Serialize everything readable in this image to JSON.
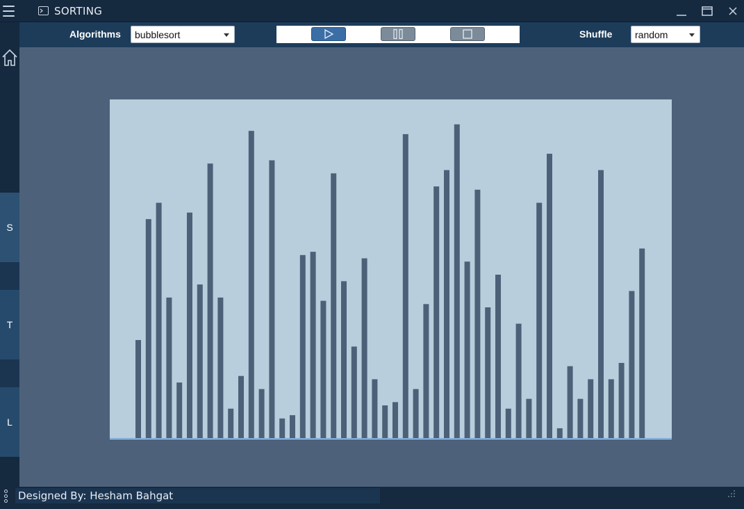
{
  "window": {
    "title": "SORTING",
    "icon": "terminal-icon",
    "controls": [
      "minimize-icon",
      "maximize-icon",
      "close-icon"
    ]
  },
  "toolbar": {
    "algorithms_label": "Algorithms",
    "algorithm_selected": "bubblesort",
    "shuffle_label": "Shuffle",
    "shuffle_selected": "random",
    "play_icon": "play-icon",
    "pause_icon": "pause-icon",
    "stop_icon": "stop-icon"
  },
  "sidebar": {
    "home_icon": "home-icon",
    "items": [
      {
        "label": "S"
      },
      {
        "label": "T"
      },
      {
        "label": "L"
      }
    ]
  },
  "footer": {
    "credit": "Designed By: Hesham Bahgat"
  },
  "colors": {
    "bar": "#4c6178",
    "chart_background": "#b9cedc",
    "baseline": "#6a9fd4",
    "play_button": "#3b6ea5",
    "inactive_button": "#7b8b99"
  },
  "chart_data": {
    "type": "bar",
    "title": "",
    "xlabel": "",
    "ylabel": "",
    "ylim": [
      0,
      100
    ],
    "values": [
      30,
      67,
      72,
      43,
      17,
      69,
      47,
      84,
      43,
      9,
      19,
      94,
      15,
      85,
      6,
      7,
      56,
      57,
      42,
      81,
      48,
      28,
      55,
      18,
      10,
      11,
      93,
      15,
      41,
      77,
      82,
      96,
      54,
      76,
      40,
      50,
      9,
      35,
      12,
      72,
      87,
      3,
      22,
      12,
      18,
      82,
      18,
      23,
      45,
      58
    ]
  }
}
